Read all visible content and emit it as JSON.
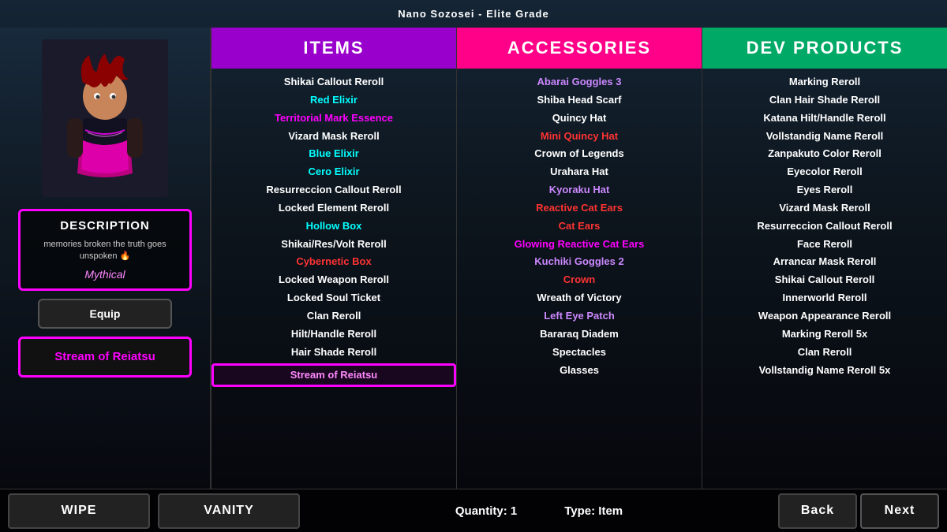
{
  "topBar": {
    "title": "Nano Sozosei - Elite Grade"
  },
  "leftPanel": {
    "descriptionLabel": "DESCRIPTION",
    "descriptionText": "memories broken the truth goes unspoken 🔥",
    "rarity": "Mythical",
    "equipLabel": "Equip",
    "streamLabel": "Stream of Reiatsu"
  },
  "columns": {
    "items": {
      "header": "ITEMS",
      "list": [
        {
          "text": "Shikai Callout Reroll",
          "color": "white"
        },
        {
          "text": "Red Elixir",
          "color": "cyan"
        },
        {
          "text": "Territorial Mark Essence",
          "color": "pink"
        },
        {
          "text": "Vizard Mask Reroll",
          "color": "white"
        },
        {
          "text": "Blue Elixir",
          "color": "cyan"
        },
        {
          "text": "Cero Elixir",
          "color": "cyan"
        },
        {
          "text": "Resurreccion Callout Reroll",
          "color": "white"
        },
        {
          "text": "Locked Element Reroll",
          "color": "white"
        },
        {
          "text": "Hollow Box",
          "color": "cyan"
        },
        {
          "text": "Shikai/Res/Volt Reroll",
          "color": "white"
        },
        {
          "text": "Cybernetic Box",
          "color": "red"
        },
        {
          "text": "Locked Weapon Reroll",
          "color": "white"
        },
        {
          "text": "Locked Soul Ticket",
          "color": "white"
        },
        {
          "text": "Clan Reroll",
          "color": "white"
        },
        {
          "text": "Hilt/Handle Reroll",
          "color": "white"
        },
        {
          "text": "Hair Shade Reroll",
          "color": "white"
        },
        {
          "text": "Stream of Reiatsu",
          "color": "pink",
          "highlight": true
        }
      ]
    },
    "accessories": {
      "header": "ACCESSORIES",
      "list": [
        {
          "text": "Abarai Goggles 3",
          "color": "purple"
        },
        {
          "text": "Shiba Head Scarf",
          "color": "white"
        },
        {
          "text": "Quincy Hat",
          "color": "white"
        },
        {
          "text": "Mini Quincy Hat",
          "color": "red"
        },
        {
          "text": "Crown of Legends",
          "color": "white"
        },
        {
          "text": "Urahara Hat",
          "color": "white"
        },
        {
          "text": "Kyoraku Hat",
          "color": "purple"
        },
        {
          "text": "Reactive Cat Ears",
          "color": "red"
        },
        {
          "text": "Cat Ears",
          "color": "red"
        },
        {
          "text": "Glowing Reactive Cat Ears",
          "color": "pink"
        },
        {
          "text": "Kuchiki Goggles 2",
          "color": "purple"
        },
        {
          "text": "Crown",
          "color": "red"
        },
        {
          "text": "Wreath of Victory",
          "color": "white"
        },
        {
          "text": "Left Eye Patch",
          "color": "purple"
        },
        {
          "text": "Bararaq Diadem",
          "color": "white"
        },
        {
          "text": "Spectacles",
          "color": "white"
        },
        {
          "text": "Glasses",
          "color": "white"
        }
      ]
    },
    "devProducts": {
      "header": "DEV PRODUCTS",
      "list": [
        {
          "text": "Marking Reroll",
          "color": "white"
        },
        {
          "text": "Clan Hair Shade Reroll",
          "color": "white"
        },
        {
          "text": "Katana Hilt/Handle Reroll",
          "color": "white"
        },
        {
          "text": "Vollstandig Name Reroll",
          "color": "white"
        },
        {
          "text": "Zanpakuto Color Reroll",
          "color": "white"
        },
        {
          "text": "Eyecolor Reroll",
          "color": "white"
        },
        {
          "text": "Eyes Reroll",
          "color": "white"
        },
        {
          "text": "Vizard Mask Reroll",
          "color": "white"
        },
        {
          "text": "Resurreccion Callout Reroll",
          "color": "white"
        },
        {
          "text": "Face Reroll",
          "color": "white"
        },
        {
          "text": "Arrancar Mask Reroll",
          "color": "white"
        },
        {
          "text": "Shikai Callout Reroll",
          "color": "white"
        },
        {
          "text": "Innerworld Reroll",
          "color": "white"
        },
        {
          "text": "Weapon Appearance Reroll",
          "color": "white"
        },
        {
          "text": "Marking Reroll 5x",
          "color": "white"
        },
        {
          "text": "Clan Reroll",
          "color": "white"
        },
        {
          "text": "Vollstandig Name Reroll 5x",
          "color": "white"
        }
      ]
    }
  },
  "bottomBar": {
    "wipe": "WIPE",
    "vanity": "VANITY",
    "quantity": "Quantity: 1",
    "type": "Type: Item",
    "back": "Back",
    "next": "Next"
  }
}
